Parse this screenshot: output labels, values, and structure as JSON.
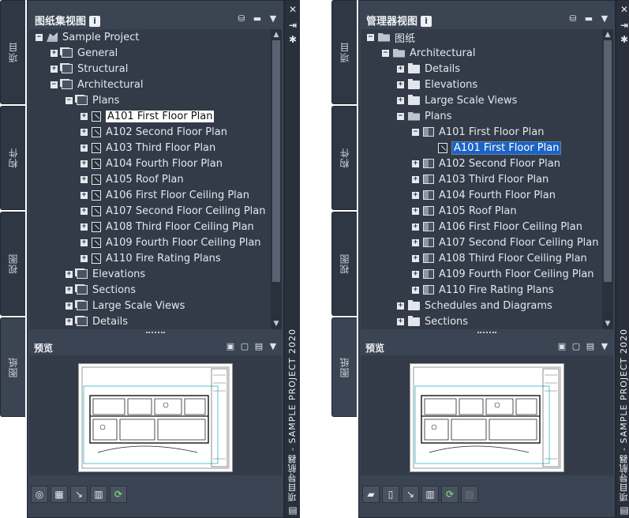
{
  "palette": {
    "panel_bg": "#3b4453",
    "tree_bg": "#333b48",
    "selection_blue": "#1b63c6",
    "refresh_green": "#6ed26a"
  },
  "left": {
    "title": "图纸集视图",
    "info": "i",
    "vertical_tabs": [
      "项目",
      "构件",
      "视图",
      "图纸"
    ],
    "active_tab": "图纸",
    "tree": [
      {
        "depth": 0,
        "expander": "minus",
        "icon": "sheet-set-icon",
        "label": "Sample Project"
      },
      {
        "depth": 1,
        "expander": "plus",
        "icon": "subset-icon",
        "label": "General"
      },
      {
        "depth": 1,
        "expander": "plus",
        "icon": "subset-icon",
        "label": "Structural"
      },
      {
        "depth": 1,
        "expander": "minus",
        "icon": "subset-icon",
        "label": "Architectural"
      },
      {
        "depth": 2,
        "expander": "minus",
        "icon": "subset-icon",
        "label": "Plans"
      },
      {
        "depth": 3,
        "expander": "plus",
        "icon": "sheet-icon",
        "label": "A101 First Floor Plan",
        "selected": "white"
      },
      {
        "depth": 3,
        "expander": "plus",
        "icon": "sheet-icon",
        "label": "A102 Second Floor Plan"
      },
      {
        "depth": 3,
        "expander": "plus",
        "icon": "sheet-icon",
        "label": "A103 Third Floor Plan"
      },
      {
        "depth": 3,
        "expander": "plus",
        "icon": "sheet-icon",
        "label": "A104 Fourth Floor Plan"
      },
      {
        "depth": 3,
        "expander": "plus",
        "icon": "sheet-icon",
        "label": "A105 Roof Plan"
      },
      {
        "depth": 3,
        "expander": "plus",
        "icon": "sheet-icon",
        "label": "A106 First Floor Ceiling Plan"
      },
      {
        "depth": 3,
        "expander": "plus",
        "icon": "sheet-icon",
        "label": "A107 Second Floor Ceiling Plan"
      },
      {
        "depth": 3,
        "expander": "plus",
        "icon": "sheet-icon",
        "label": "A108 Third Floor Ceiling Plan"
      },
      {
        "depth": 3,
        "expander": "plus",
        "icon": "sheet-icon",
        "label": "A109 Fourth Floor Ceiling Plan"
      },
      {
        "depth": 3,
        "expander": "plus",
        "icon": "sheet-icon",
        "label": "A110 Fire Rating Plans"
      },
      {
        "depth": 2,
        "expander": "plus",
        "icon": "subset-icon",
        "label": "Elevations"
      },
      {
        "depth": 2,
        "expander": "plus",
        "icon": "subset-icon",
        "label": "Sections"
      },
      {
        "depth": 2,
        "expander": "plus",
        "icon": "subset-icon",
        "label": "Large Scale Views"
      },
      {
        "depth": 2,
        "expander": "plus",
        "icon": "subset-icon",
        "label": "Details"
      }
    ],
    "preview_label": "预览",
    "bottom_tools": [
      "sheet-set-icon",
      "new-sheet-icon",
      "view-icon",
      "layout-icon",
      "refresh-icon"
    ],
    "vertical_title": "项目导航器 - SAMPLE PROJECT 2020"
  },
  "right": {
    "title": "管理器视图",
    "info": "i",
    "vertical_tabs": [
      "项目",
      "构件",
      "视图",
      "图纸"
    ],
    "active_tab": "图纸",
    "tree": [
      {
        "depth": 0,
        "expander": "minus",
        "icon": "folder-open-icon",
        "label": "图纸"
      },
      {
        "depth": 1,
        "expander": "minus",
        "icon": "folder-open-icon",
        "label": "Architectural"
      },
      {
        "depth": 2,
        "expander": "plus",
        "icon": "folder-icon",
        "label": "Details"
      },
      {
        "depth": 2,
        "expander": "plus",
        "icon": "folder-icon",
        "label": "Elevations"
      },
      {
        "depth": 2,
        "expander": "plus",
        "icon": "folder-icon",
        "label": "Large Scale Views"
      },
      {
        "depth": 2,
        "expander": "minus",
        "icon": "folder-open-icon",
        "label": "Plans"
      },
      {
        "depth": 3,
        "expander": "minus",
        "icon": "view-icon",
        "label": "A101 First Floor Plan"
      },
      {
        "depth": 4,
        "expander": "none",
        "icon": "sheet-icon",
        "label": "A101 First Floor Plan",
        "selected": "blue"
      },
      {
        "depth": 3,
        "expander": "plus",
        "icon": "view-icon",
        "label": "A102 Second Floor Plan"
      },
      {
        "depth": 3,
        "expander": "plus",
        "icon": "view-icon",
        "label": "A103 Third Floor Plan"
      },
      {
        "depth": 3,
        "expander": "plus",
        "icon": "view-icon",
        "label": "A104 Fourth Floor Plan"
      },
      {
        "depth": 3,
        "expander": "plus",
        "icon": "view-icon",
        "label": "A105 Roof Plan"
      },
      {
        "depth": 3,
        "expander": "plus",
        "icon": "view-icon",
        "label": "A106 First Floor Ceiling Plan"
      },
      {
        "depth": 3,
        "expander": "plus",
        "icon": "view-icon",
        "label": "A107 Second Floor Ceiling Plan"
      },
      {
        "depth": 3,
        "expander": "plus",
        "icon": "view-icon",
        "label": "A108 Third Floor Ceiling Plan"
      },
      {
        "depth": 3,
        "expander": "plus",
        "icon": "view-icon",
        "label": "A109 Fourth Floor Ceiling Plan"
      },
      {
        "depth": 3,
        "expander": "plus",
        "icon": "view-icon",
        "label": "A110 Fire Rating Plans"
      },
      {
        "depth": 2,
        "expander": "plus",
        "icon": "folder-icon",
        "label": "Schedules and Diagrams"
      },
      {
        "depth": 2,
        "expander": "plus",
        "icon": "folder-icon",
        "label": "Sections"
      }
    ],
    "preview_label": "预览",
    "bottom_tools": [
      "new-folder-icon",
      "new-sheet-icon",
      "view-icon",
      "layout-icon",
      "refresh-icon",
      "delete-icon"
    ],
    "vertical_title": "项目导航器 - SAMPLE PROJECT 2020"
  }
}
